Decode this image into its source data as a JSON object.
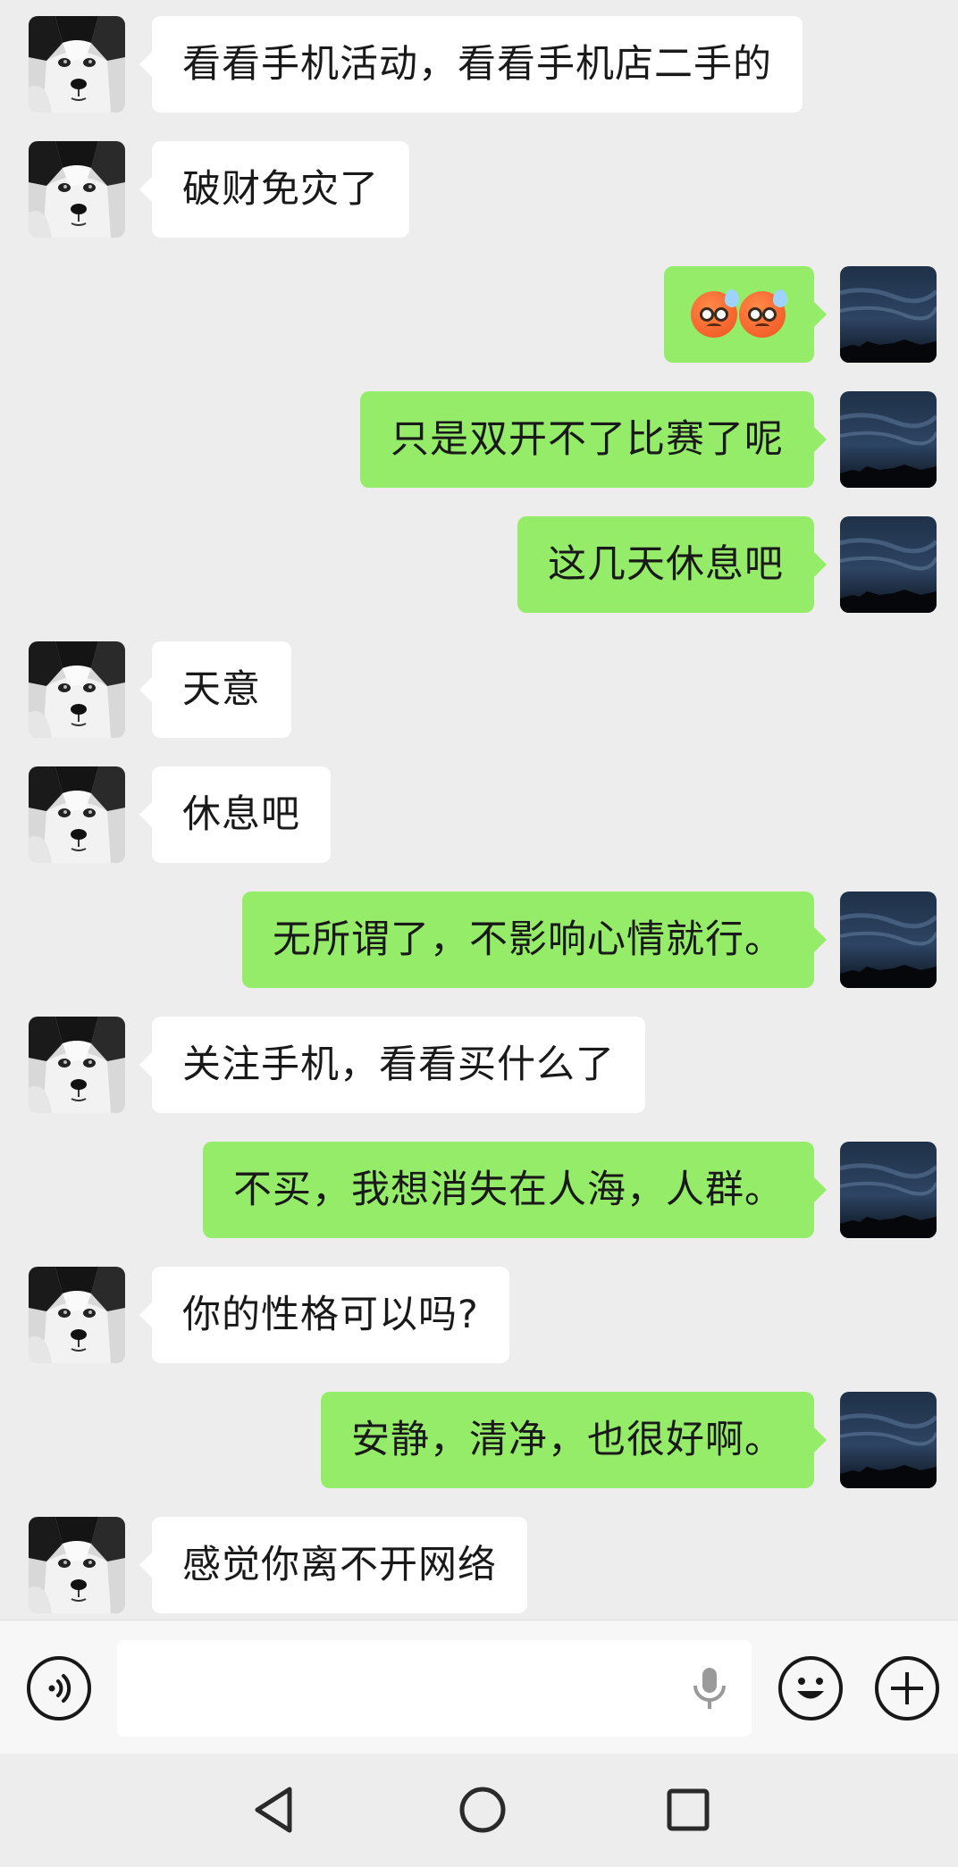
{
  "messages": [
    {
      "side": "left",
      "text": "看看手机活动，看看手机店二手的"
    },
    {
      "side": "left",
      "text": "破财免灾了"
    },
    {
      "side": "right",
      "text": "",
      "emoji": "sweat-frown-face-emoji x2"
    },
    {
      "side": "right",
      "text": "只是双开不了比赛了呢"
    },
    {
      "side": "right",
      "text": "这几天休息吧"
    },
    {
      "side": "left",
      "text": "天意"
    },
    {
      "side": "left",
      "text": "休息吧"
    },
    {
      "side": "right",
      "text": "无所谓了，不影响心情就行。"
    },
    {
      "side": "left",
      "text": "关注手机，看看买什么了"
    },
    {
      "side": "right",
      "text": "不买，我想消失在人海，人群。"
    },
    {
      "side": "left",
      "text": "你的性格可以吗?"
    },
    {
      "side": "right",
      "text": "安静，清净，也很好啊。"
    },
    {
      "side": "left",
      "text": "感觉你离不开网络"
    }
  ],
  "input_bar": {
    "message_value": "",
    "icons": [
      "voice-icon",
      "mic-icon",
      "emoji-icon",
      "plus-icon"
    ]
  },
  "nav_bar": {
    "icons": [
      "back-icon",
      "home-icon",
      "recent-apps-icon"
    ]
  },
  "colors": {
    "background": "#ededed",
    "incoming_bubble": "#ffffff",
    "outgoing_bubble": "#95ec69",
    "text": "#191919"
  }
}
